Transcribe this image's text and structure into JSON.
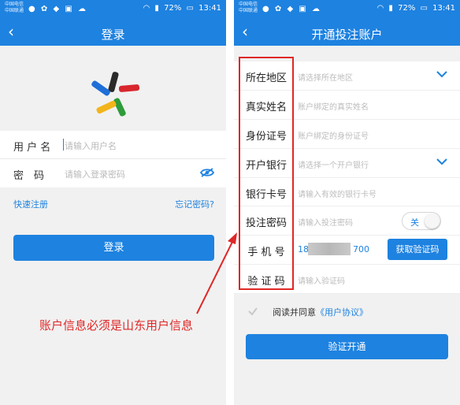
{
  "status_bar": {
    "carrier_line1": "中国电信",
    "carrier_line2": "中国联通",
    "battery": "72%",
    "time": "13:41"
  },
  "login_screen": {
    "title": "登录",
    "username_label": "用 户 名",
    "username_placeholder": "请输入用户名",
    "password_label": "密　码",
    "password_placeholder": "请输入登录密码",
    "quick_register": "快速注册",
    "forgot_password": "忘记密码?",
    "login_button": "登录"
  },
  "register_screen": {
    "title": "开通投注账户",
    "fields": [
      {
        "label": "所在地区",
        "placeholder": "请选择所在地区",
        "type": "dropdown"
      },
      {
        "label": "真实姓名",
        "placeholder": "账户绑定的真实姓名",
        "type": "text"
      },
      {
        "label": "身份证号",
        "placeholder": "账户绑定的身份证号",
        "type": "text"
      },
      {
        "label": "开户银行",
        "placeholder": "请选择一个开户银行",
        "type": "dropdown"
      },
      {
        "label": "银行卡号",
        "placeholder": "请输入有效的银行卡号",
        "type": "text"
      },
      {
        "label": "投注密码",
        "placeholder": "请输入投注密码",
        "type": "toggle"
      },
      {
        "label": "手 机 号",
        "value_prefix": "18",
        "value_suffix": "700",
        "type": "phone"
      },
      {
        "label": "验 证 码",
        "placeholder": "请输入验证码",
        "type": "text"
      }
    ],
    "toggle_label": "关",
    "get_code_button": "获取验证码",
    "agree_text": "阅读并同意",
    "agree_link": "《用户协议》",
    "verify_button": "验证开通"
  },
  "annotation": {
    "text": "账户信息必须是山东用户信息",
    "color": "#e02727"
  },
  "colors": {
    "primary": "#1e82e0",
    "background": "#f1f1f1"
  }
}
